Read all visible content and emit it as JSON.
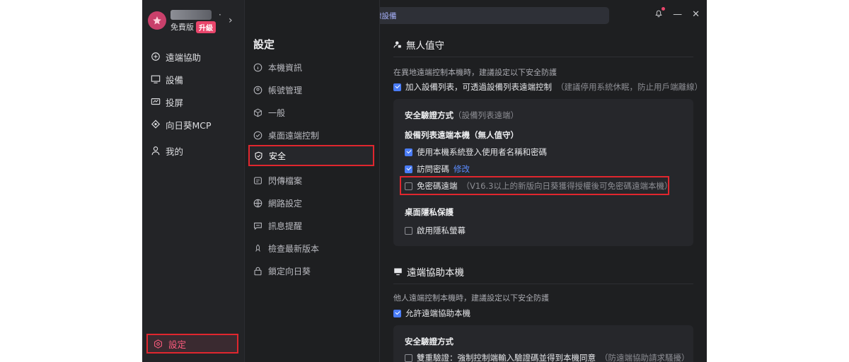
{
  "user": {
    "edition": "免費版",
    "upgrade": "升級"
  },
  "sidebar": {
    "items": [
      {
        "label": "遠端協助",
        "icon": "remote-assist-icon"
      },
      {
        "label": "設備",
        "icon": "monitor-icon"
      },
      {
        "label": "投屏",
        "icon": "cast-icon"
      },
      {
        "label": "向日葵MCP",
        "icon": "mcp-icon"
      },
      {
        "label": "我的",
        "icon": "user-icon"
      }
    ],
    "settings_label": "設定"
  },
  "search": {
    "placeholder": "搜尋/連線設備"
  },
  "settings_menu": {
    "title": "設定",
    "items": [
      {
        "label": "本機資訊"
      },
      {
        "label": "帳號管理"
      },
      {
        "label": "一般"
      },
      {
        "label": "桌面遠端控制"
      },
      {
        "label": "安全"
      },
      {
        "label": "閃傳檔案"
      },
      {
        "label": "網路設定"
      },
      {
        "label": "訊息提醒"
      },
      {
        "label": "檢查最新版本"
      },
      {
        "label": "鎖定向日葵"
      }
    ]
  },
  "unattended": {
    "title": "無人值守",
    "desc": "在異地遠端控制本機時，建議設定以下安全防護",
    "add_device": {
      "label": "加入設備列表，可透過設備列表遠端控制",
      "hint": "（建議停用系統休眠，防止用戶端離線）",
      "checked": true
    },
    "card": {
      "auth_title": "安全驗證方式",
      "auth_hint": "（設備列表遠端）",
      "sub_title": "設備列表遠端本機（無人值守）",
      "opt_system_login": {
        "label": "使用本機系統登入使用者名稱和密碼",
        "checked": true
      },
      "opt_access_pwd": {
        "label": "訪問密碼",
        "link": "修改",
        "checked": true
      },
      "opt_no_pwd": {
        "label": "免密碼遠端",
        "hint": "（V16.3以上的新版向日葵獲得授權後可免密碼遠端本機）",
        "checked": false
      },
      "privacy_title": "桌面隱私保護",
      "opt_privacy": {
        "label": "啟用隱私螢幕",
        "checked": false
      }
    }
  },
  "assist": {
    "title": "遠端協助本機",
    "desc": "他人遠端控制本機時，建議設定以下安全防護",
    "allow": {
      "label": "允許遠端協助本機",
      "checked": true
    },
    "card": {
      "auth_title": "安全驗證方式",
      "opt_double": {
        "label": "雙重驗證：強制控制端輸入驗證碼並得到本機同意",
        "hint": "（防遠端協助請求騷擾）",
        "checked": false
      }
    }
  }
}
